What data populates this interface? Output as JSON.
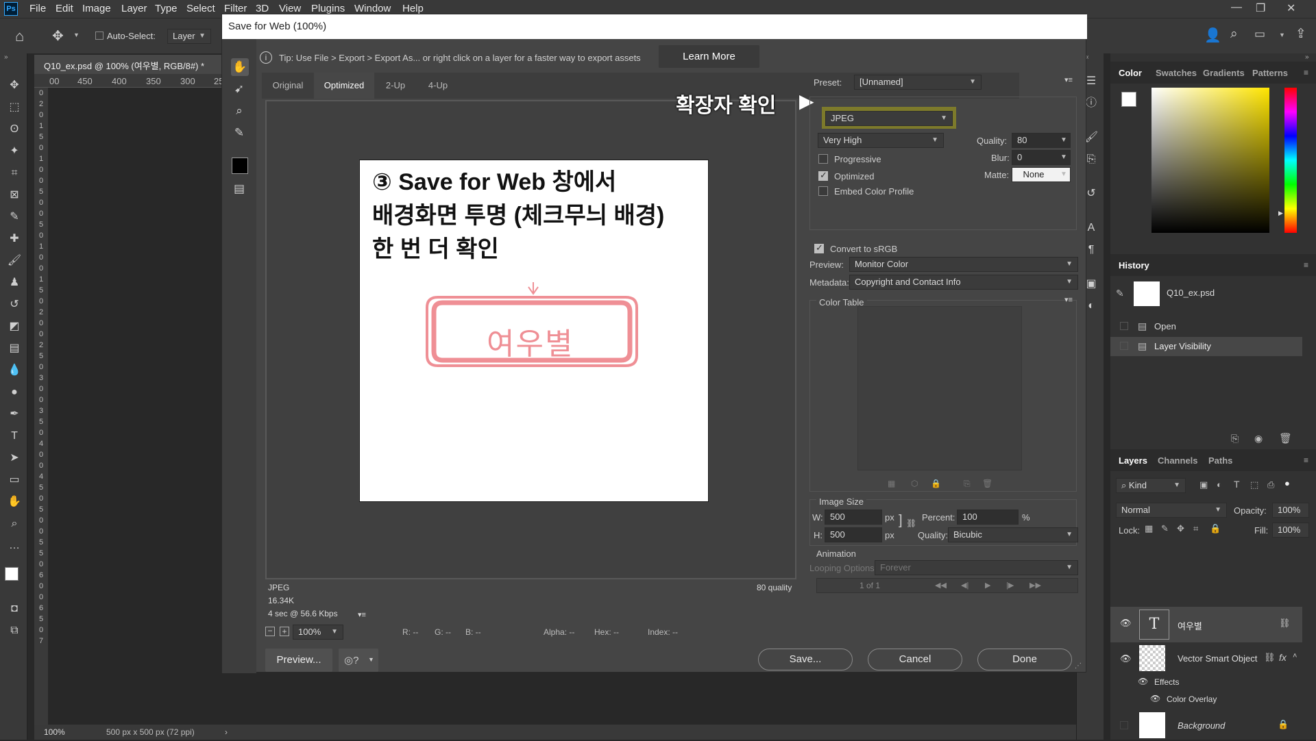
{
  "menubar": {
    "items": [
      "File",
      "Edit",
      "Image",
      "Layer",
      "Type",
      "Select",
      "Filter",
      "3D",
      "View",
      "Plugins",
      "Window",
      "Help"
    ]
  },
  "options": {
    "auto_select_label": "Auto-Select:",
    "auto_select_value": "Layer"
  },
  "document": {
    "tab_title": "Q10_ex.psd @ 100% (여우별, RGB/8#) *",
    "ruler_top": [
      "00",
      "450",
      "400",
      "350",
      "300",
      "25"
    ],
    "ruler_left": [
      "0",
      "2",
      "0",
      "1",
      "5",
      "0",
      "1",
      "0",
      "0",
      "5",
      "0",
      "0",
      "5",
      "0",
      "1",
      "0",
      "0",
      "1",
      "5",
      "0",
      "2",
      "0",
      "0",
      "2",
      "5",
      "0",
      "3",
      "0",
      "0",
      "3",
      "5",
      "0",
      "4",
      "0",
      "0",
      "4",
      "5",
      "0",
      "5",
      "0",
      "0",
      "5",
      "5",
      "0",
      "6",
      "0",
      "0",
      "6",
      "5",
      "0",
      "7"
    ],
    "zoom": "100%",
    "info": "500 px x 500 px (72 ppi)"
  },
  "dialog": {
    "title": "Save for Web (100%)",
    "tip": "Tip: Use File > Export > Export As...  or right click on a layer for a faster way to export assets",
    "learn_more": "Learn More",
    "tabs": [
      "Original",
      "Optimized",
      "2-Up",
      "4-Up"
    ],
    "active_tab": "Optimized",
    "preview": {
      "heading_lines": [
        "③ Save for Web 창에서",
        "배경화면 투명 (체크무늬 배경)",
        "한 번 더 확인"
      ],
      "logo_text": "여우별",
      "format": "JPEG",
      "size": "16.34K",
      "speed": "4 sec @ 56.6 Kbps",
      "quality_note": "80 quality"
    },
    "zoom_bar": {
      "zoom": "100%",
      "r": "R: --",
      "g": "G: --",
      "b": "B: --",
      "alpha": "Alpha: --",
      "hex": "Hex: --",
      "index": "Index: --"
    },
    "buttons": {
      "preview": "Preview...",
      "save": "Save...",
      "cancel": "Cancel",
      "done": "Done"
    },
    "annotation": "확장자 확인",
    "settings": {
      "preset_label": "Preset:",
      "preset_value": "[Unnamed]",
      "format_value": "JPEG",
      "quality_preset": "Very High",
      "quality_label": "Quality:",
      "quality_value": "80",
      "blur_label": "Blur:",
      "blur_value": "0",
      "matte_label": "Matte:",
      "matte_value": "None",
      "progressive": "Progressive",
      "optimized": "Optimized",
      "embed_profile": "Embed Color Profile",
      "convert_srgb": "Convert to sRGB",
      "preview_label": "Preview:",
      "preview_value": "Monitor Color",
      "metadata_label": "Metadata:",
      "metadata_value": "Copyright and Contact Info",
      "color_table": "Color Table",
      "image_size": "Image Size",
      "w_label": "W:",
      "w_value": "500",
      "h_label": "H:",
      "h_value": "500",
      "px": "px",
      "percent_label": "Percent:",
      "percent_value": "100",
      "percent_sign": "%",
      "resample_label": "Quality:",
      "resample_value": "Bicubic",
      "animation": "Animation",
      "looping_label": "Looping Options:",
      "looping_value": "Forever",
      "frame_counter": "1 of 1"
    }
  },
  "panels": {
    "color_tabs": [
      "Color",
      "Swatches",
      "Gradients",
      "Patterns"
    ],
    "history_title": "History",
    "history_items": [
      "Q10_ex.psd",
      "Open",
      "Layer Visibility"
    ],
    "layers_tabs": [
      "Layers",
      "Channels",
      "Paths"
    ],
    "kind_label": "Kind",
    "blend_mode": "Normal",
    "opacity_label": "Opacity:",
    "opacity_value": "100%",
    "lock_label": "Lock:",
    "fill_label": "Fill:",
    "fill_value": "100%",
    "layers": [
      "여우별",
      "Vector Smart Object",
      "Effects",
      "Color Overlay",
      "Background"
    ]
  }
}
